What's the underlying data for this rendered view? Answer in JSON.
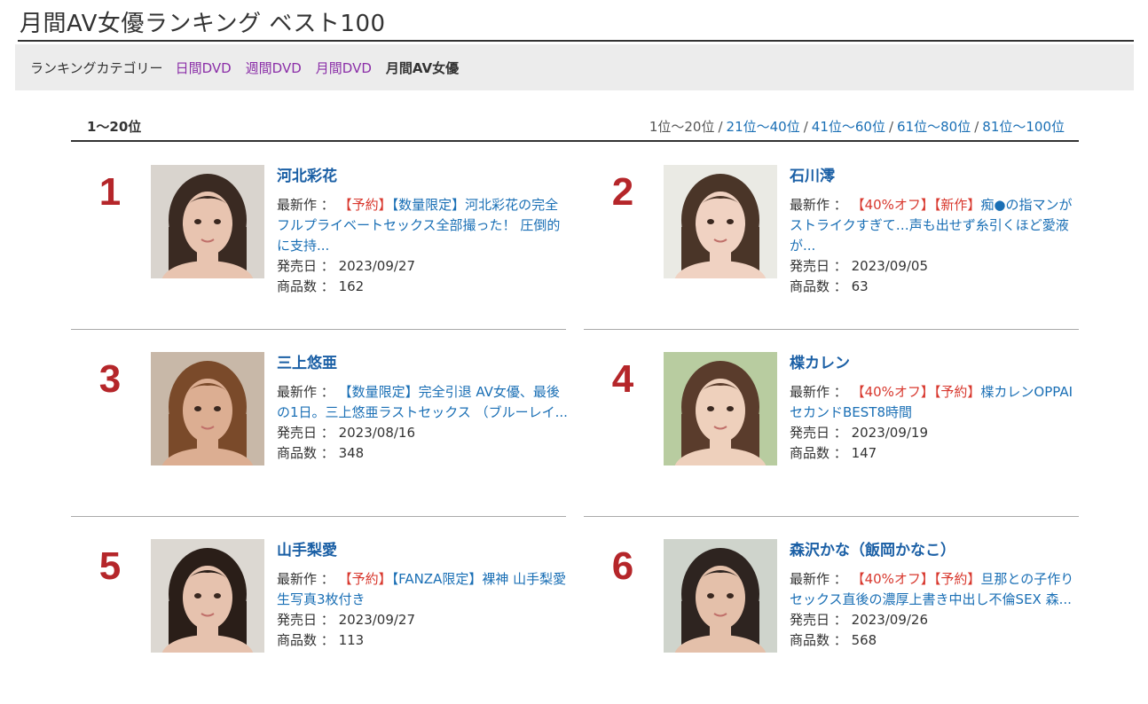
{
  "page": {
    "title": "月間AV女優ランキング ベスト100"
  },
  "category": {
    "label": "ランキングカテゴリー",
    "links": [
      "日間DVD",
      "週間DVD",
      "月間DVD"
    ],
    "current": "月間AV女優"
  },
  "range": {
    "current": "1〜20位",
    "pager_current": "1位〜20位",
    "pager_sep": "/",
    "pager_links": [
      "21位〜40位",
      "41位〜60位",
      "61位〜80位",
      "81位〜100位"
    ]
  },
  "labels": {
    "latest": "最新作 ：",
    "release": "発売日 ：",
    "count": "商品数 ："
  },
  "actresses": [
    {
      "rank": "1",
      "name": "河北彩花",
      "tags": [
        {
          "text": "【予約】",
          "color": "red"
        },
        {
          "text": "【数量限定】",
          "color": "blue"
        }
      ],
      "title": "河北彩花の完全フルプライベートセックス全部撮った！ 圧倒的に支持...",
      "release": "2023/09/27",
      "count": "162"
    },
    {
      "rank": "2",
      "name": "石川澪",
      "tags": [
        {
          "text": "【40%オフ】",
          "color": "red"
        },
        {
          "text": "【新作】",
          "color": "red"
        }
      ],
      "title": "痴●の指マンがストライクすぎて…声も出せず糸引くほど愛液が...",
      "release": "2023/09/05",
      "count": "63"
    },
    {
      "rank": "3",
      "name": "三上悠亜",
      "tags": [
        {
          "text": "【数量限定】",
          "color": "blue"
        }
      ],
      "title": "完全引退 AV女優、最後の1日。三上悠亜ラストセックス （ブルーレイ...",
      "release": "2023/08/16",
      "count": "348"
    },
    {
      "rank": "4",
      "name": "楪カレン",
      "tags": [
        {
          "text": "【40%オフ】",
          "color": "red"
        },
        {
          "text": "【予約】",
          "color": "red"
        }
      ],
      "title": "楪カレンOPPAIセカンドBEST8時間",
      "release": "2023/09/19",
      "count": "147"
    },
    {
      "rank": "5",
      "name": "山手梨愛",
      "tags": [
        {
          "text": "【予約】",
          "color": "red"
        },
        {
          "text": "【FANZA限定】",
          "color": "blue"
        }
      ],
      "title": "裸神 山手梨愛 生写真3枚付き",
      "release": "2023/09/27",
      "count": "113"
    },
    {
      "rank": "6",
      "name": "森沢かな（飯岡かなこ）",
      "tags": [
        {
          "text": "【40%オフ】",
          "color": "red"
        },
        {
          "text": "【予約】",
          "color": "red"
        }
      ],
      "title": "旦那との子作りセックス直後の濃厚上書き中出し不倫SEX 森...",
      "release": "2023/09/26",
      "count": "568"
    }
  ],
  "colors": {
    "rank": "#b5262a",
    "link": "#1a5fa5",
    "tag_red": "#d8382e",
    "category_link": "#8b2fa8"
  }
}
